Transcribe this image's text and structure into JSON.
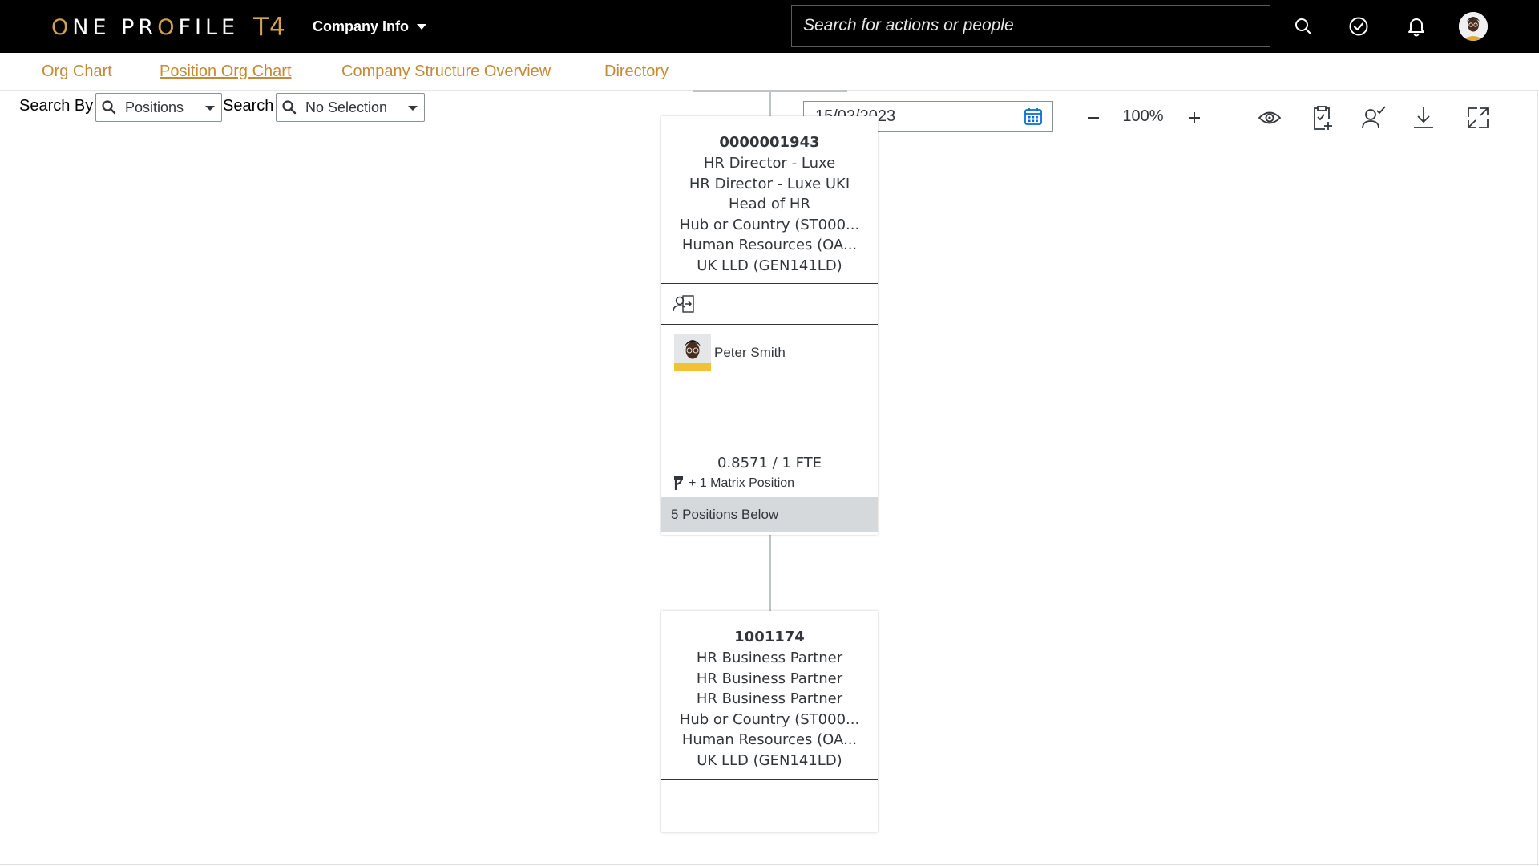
{
  "shell": {
    "logo_main": "ONE PROFILE",
    "logo_suffix": "T4",
    "menu_label": "Company Info",
    "search_placeholder": "Search for actions or people",
    "icons": [
      "search-icon",
      "tasks-check-icon",
      "bell-icon",
      "user-avatar"
    ]
  },
  "tabs": [
    {
      "label": "Org Chart",
      "active": false
    },
    {
      "label": "Position Org Chart",
      "active": true
    },
    {
      "label": "Company Structure Overview",
      "active": false
    },
    {
      "label": "Directory",
      "active": false
    }
  ],
  "filters": {
    "search_by_label": "Search By",
    "search_by_value": "Positions",
    "search_label": "Search",
    "search_value": "No Selection"
  },
  "toolbar": {
    "date": "15/02/2023",
    "zoom": "100%",
    "icons": [
      "calendar-icon",
      "zoom-out-icon",
      "zoom-in-icon",
      "eye-icon",
      "add-clipboard-icon",
      "user-check-icon",
      "download-icon",
      "fullscreen-icon"
    ]
  },
  "positions": [
    {
      "id": "0000001943",
      "lines": [
        "HR Director - Luxe",
        "HR Director - Luxe UKI",
        "Head of HR",
        "Hub or Country (ST000...",
        "Human Resources (OA...",
        "UK LLD (GEN141LD)"
      ],
      "incumbent": "Peter Smith",
      "fte": "0.8571 / 1 FTE",
      "matrix": "+ 1 Matrix Position",
      "below": "5 Positions Below"
    },
    {
      "id": "1001174",
      "lines": [
        "HR Business Partner",
        "HR Business Partner",
        "HR Business Partner",
        "Hub or Country (ST000...",
        "Human Resources (OA...",
        "UK LLD (GEN141LD)"
      ]
    }
  ],
  "colors": {
    "shell_bg": "#000000",
    "accent_gold": "#c48a35",
    "below_bar": "#d5d9dc"
  }
}
